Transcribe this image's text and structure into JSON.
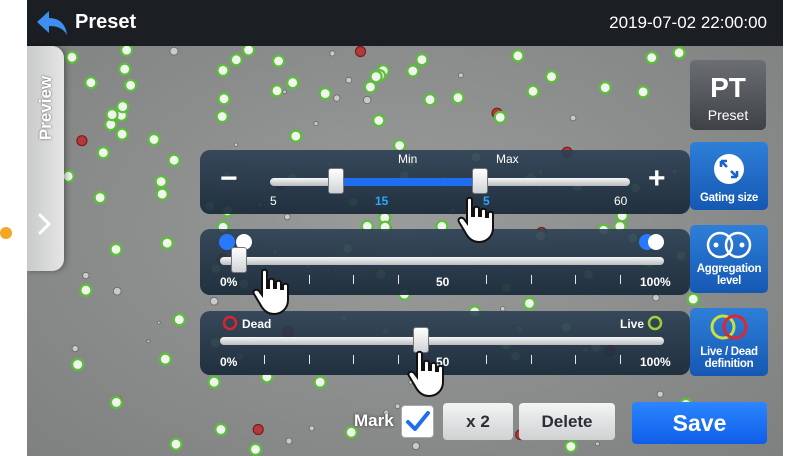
{
  "header": {
    "title": "Preset",
    "datetime": "2019-07-02  22:00:00"
  },
  "sidebar": {
    "preview_label": "Preview"
  },
  "preset_button": {
    "big": "PT",
    "small": "Preset"
  },
  "gating": {
    "minus": "−",
    "plus": "+",
    "min_label": "Min",
    "max_label": "Max",
    "range_start": "5",
    "range_end": "60",
    "min_value": "15",
    "max_value_partial": "5",
    "button_label": "Gating size",
    "min_fraction": 0.18,
    "max_fraction": 0.58
  },
  "aggregation": {
    "labels": [
      "0%",
      "50",
      "100%"
    ],
    "button_label_1": "Aggregation",
    "button_label_2": "level",
    "value_fraction": 0.04
  },
  "live_dead": {
    "dead_label": "Dead",
    "live_label": "Live",
    "labels": [
      "0%",
      "50",
      "100%"
    ],
    "button_label_1": "Live / Dead",
    "button_label_2": "definition",
    "value_fraction": 0.45
  },
  "bottom": {
    "mark_label": "Mark",
    "mark_checked": true,
    "zoom_label": "x 2",
    "delete_label": "Delete",
    "save_label": "Save"
  },
  "colors": {
    "accent_blue": "#1565e0",
    "live_green": "#9bd23a",
    "dead_red": "#d8262f",
    "orange_dot": "#f5a623"
  }
}
